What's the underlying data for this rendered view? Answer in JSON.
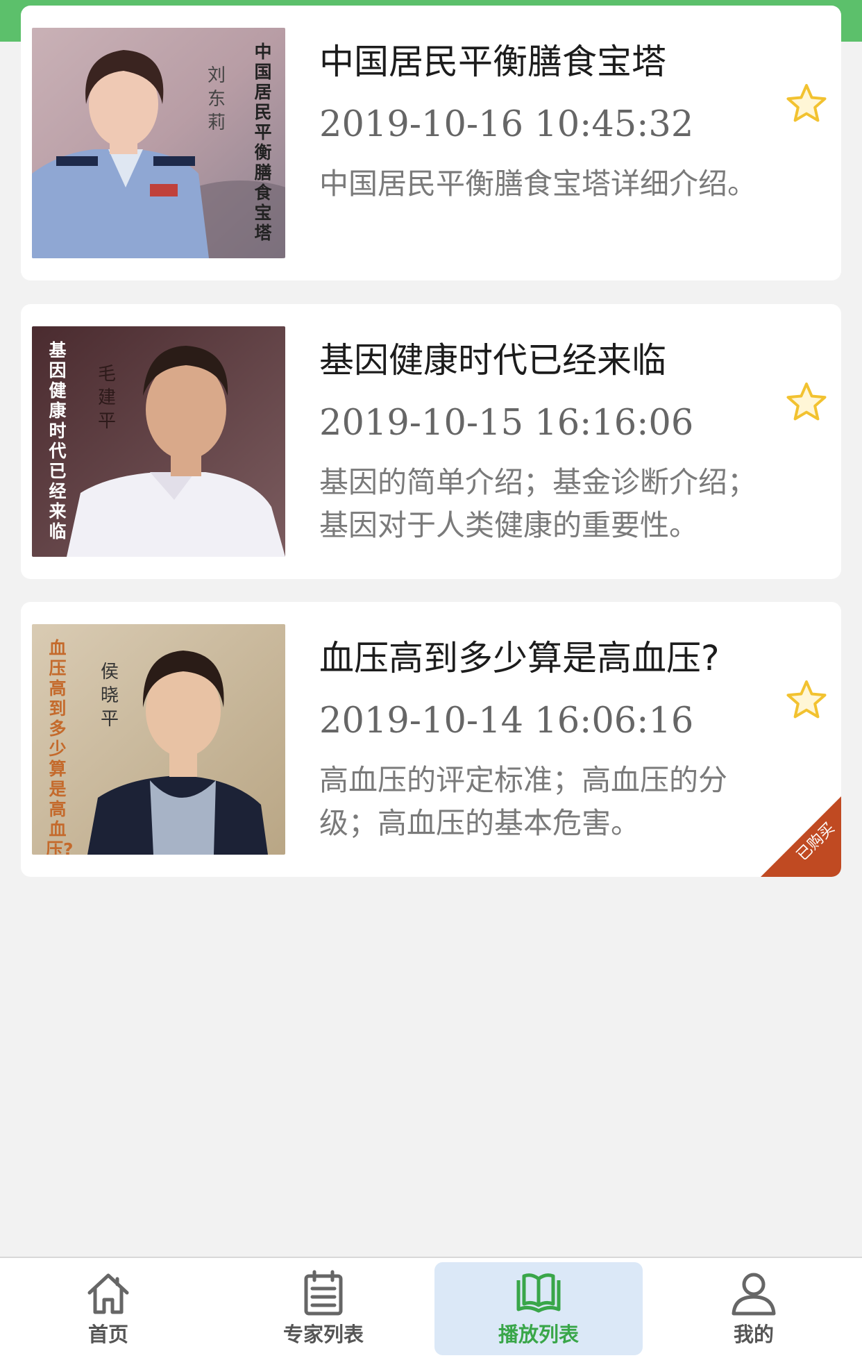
{
  "playlist": [
    {
      "title": "中国居民平衡膳食宝塔",
      "time": "2019-10-16 10:45:32",
      "desc": "中国居民平衡膳食宝塔详细介绍。",
      "thumb_title": "中国居民平衡膳食宝塔",
      "thumb_name": "刘东莉",
      "favorite_icon": "star-outline-icon",
      "purchased": false
    },
    {
      "title": "基因健康时代已经来临",
      "time": "2019-10-15 16:16:06",
      "desc": "基因的简单介绍；基金诊断介绍；基因对于人类健康的重要性。",
      "thumb_title": "基因健康时代已经来临",
      "thumb_name": "毛建平",
      "favorite_icon": "star-outline-icon",
      "purchased": false
    },
    {
      "title": "血压高到多少算是高血压?",
      "time": "2019-10-14 16:06:16",
      "desc": "高血压的评定标准；高血压的分级；高血压的基本危害。",
      "thumb_title": "血压高到多少算是高血压?",
      "thumb_name": "侯晓平",
      "favorite_icon": "star-outline-icon",
      "purchased": true,
      "purchased_label": "已购买"
    }
  ],
  "tabbar": {
    "active_index": 2,
    "items": [
      {
        "label": "首页",
        "icon": "home-icon"
      },
      {
        "label": "专家列表",
        "icon": "list-icon"
      },
      {
        "label": "播放列表",
        "icon": "book-icon"
      },
      {
        "label": "我的",
        "icon": "user-icon"
      }
    ]
  },
  "colors": {
    "accent_green": "#5cc06b",
    "active_tab_bg": "#dbe8f7",
    "active_tab_text": "#39a649",
    "star": "#f2c230",
    "ribbon": "#c04a22"
  }
}
